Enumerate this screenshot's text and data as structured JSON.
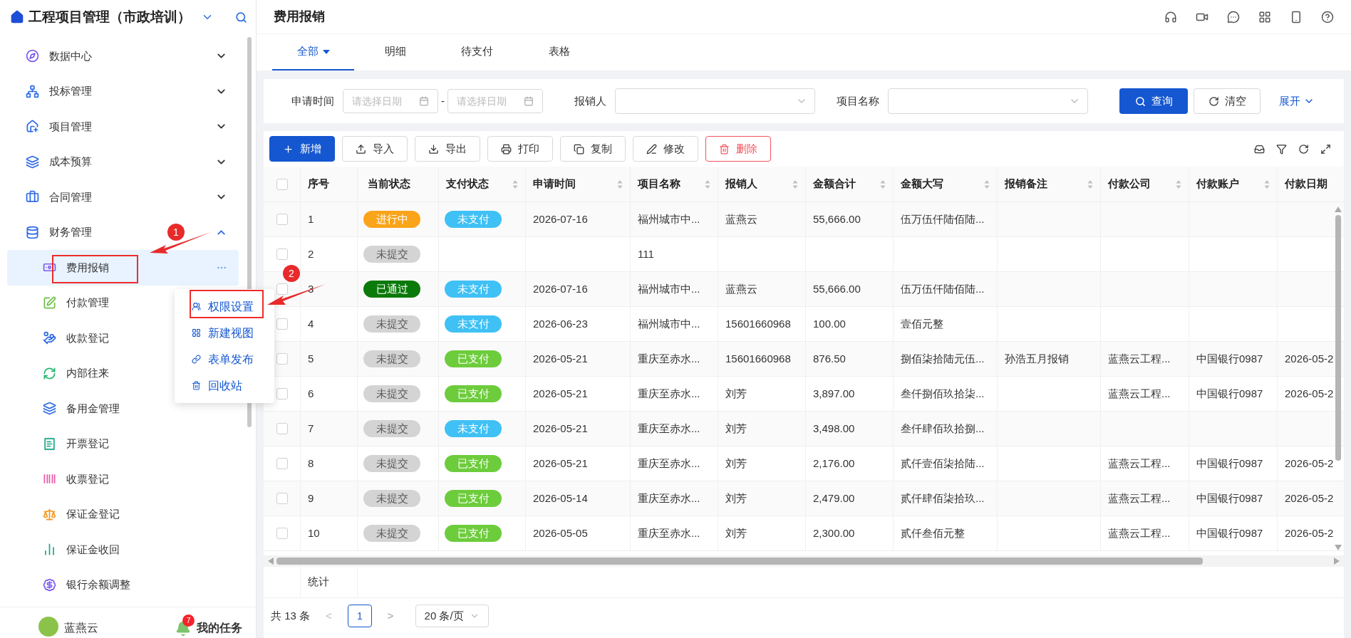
{
  "app": {
    "title": "工程项目管理（市政培训）"
  },
  "sidebar": {
    "items": [
      {
        "label": "数据中心",
        "expanded": false
      },
      {
        "label": "投标管理",
        "expanded": false
      },
      {
        "label": "项目管理",
        "expanded": false
      },
      {
        "label": "成本预算",
        "expanded": false
      },
      {
        "label": "合同管理",
        "expanded": false
      },
      {
        "label": "财务管理",
        "expanded": true,
        "children": [
          {
            "label": "费用报销",
            "selected": true
          },
          {
            "label": "付款管理",
            "selected": false
          },
          {
            "label": "收款登记",
            "selected": false
          },
          {
            "label": "内部往来",
            "selected": false
          },
          {
            "label": "备用金管理",
            "selected": false
          },
          {
            "label": "开票登记",
            "selected": false
          },
          {
            "label": "收票登记",
            "selected": false
          },
          {
            "label": "保证金登记",
            "selected": false
          },
          {
            "label": "保证金收回",
            "selected": false
          },
          {
            "label": "银行余额调整",
            "selected": false
          }
        ]
      }
    ],
    "user": {
      "name": "蓝燕云"
    },
    "tasks": {
      "label": "我的任务",
      "badge": "7"
    }
  },
  "context_menu": {
    "items": [
      "权限设置",
      "新建视图",
      "表单发布",
      "回收站"
    ]
  },
  "annotations": [
    {
      "number": "1"
    },
    {
      "number": "2"
    }
  ],
  "page": {
    "title": "费用报销"
  },
  "tabs": [
    {
      "label": "全部",
      "selected": true
    },
    {
      "label": "明细",
      "selected": false
    },
    {
      "label": "待支付",
      "selected": false
    },
    {
      "label": "表格",
      "selected": false
    }
  ],
  "filters": {
    "date_label": "申请时间",
    "date_start_placeholder": "请选择日期",
    "date_separator": "-",
    "date_end_placeholder": "请选择日期",
    "reporter_label": "报销人",
    "project_label": "项目名称",
    "query_button": "查询",
    "clear_button": "清空",
    "expand_link": "展开"
  },
  "toolbar": [
    {
      "label": "新增",
      "kind": "primary"
    },
    {
      "label": "导入",
      "kind": "default"
    },
    {
      "label": "导出",
      "kind": "default"
    },
    {
      "label": "打印",
      "kind": "default"
    },
    {
      "label": "复制",
      "kind": "default"
    },
    {
      "label": "修改",
      "kind": "default"
    },
    {
      "label": "删除",
      "kind": "danger"
    }
  ],
  "table": {
    "header_checked": false,
    "columns": [
      {
        "label": "序号",
        "sortable": false
      },
      {
        "label": "当前状态",
        "sortable": false
      },
      {
        "label": "支付状态",
        "sortable": true
      },
      {
        "label": "申请时间",
        "sortable": true
      },
      {
        "label": "项目名称",
        "sortable": true
      },
      {
        "label": "报销人",
        "sortable": true
      },
      {
        "label": "金额合计",
        "sortable": true
      },
      {
        "label": "金额大写",
        "sortable": true
      },
      {
        "label": "报销备注",
        "sortable": true
      },
      {
        "label": "付款公司",
        "sortable": true
      },
      {
        "label": "付款账户",
        "sortable": true
      },
      {
        "label": "付款日期",
        "sortable": false
      }
    ],
    "rows": [
      {
        "checked": false,
        "no": "1",
        "status": {
          "text": "进行中",
          "color": "#faa419"
        },
        "pay": {
          "text": "未支付",
          "color": "#3fc1f5"
        },
        "date": "2026-07-16",
        "project": "福州城市中...",
        "reporter": "蓝燕云",
        "amount": "55,666.00",
        "amount_words": "伍万伍仟陆佰陆...",
        "remark": "",
        "company": "",
        "account": "",
        "pay_date": ""
      },
      {
        "checked": false,
        "no": "2",
        "status": {
          "text": "未提交",
          "color": "#d4d4d4"
        },
        "date": "",
        "project": "111",
        "reporter": "",
        "amount": "",
        "amount_words": "",
        "remark": "",
        "company": "",
        "account": "",
        "pay_date": ""
      },
      {
        "checked": false,
        "no": "3",
        "status": {
          "text": "已通过",
          "color": "#0a7a0a"
        },
        "pay": {
          "text": "未支付",
          "color": "#3fc1f5"
        },
        "date": "2026-07-16",
        "project": "福州城市中...",
        "reporter": "蓝燕云",
        "amount": "55,666.00",
        "amount_words": "伍万伍仟陆佰陆...",
        "remark": "",
        "company": "",
        "account": "",
        "pay_date": ""
      },
      {
        "checked": false,
        "no": "4",
        "status": {
          "text": "未提交",
          "color": "#d4d4d4"
        },
        "pay": {
          "text": "未支付",
          "color": "#3fc1f5"
        },
        "date": "2026-06-23",
        "project": "福州城市中...",
        "reporter": "15601660968",
        "amount": "100.00",
        "amount_words": "壹佰元整",
        "remark": "",
        "company": "",
        "account": "",
        "pay_date": ""
      },
      {
        "checked": false,
        "no": "5",
        "status": {
          "text": "未提交",
          "color": "#d4d4d4"
        },
        "pay": {
          "text": "已支付",
          "color": "#6dcc3c"
        },
        "date": "2026-05-21",
        "project": "重庆至赤水...",
        "reporter": "15601660968",
        "amount": "876.50",
        "amount_words": "捌佰柒拾陆元伍...",
        "remark": "孙浩五月报销",
        "company": "蓝燕云工程...",
        "account": "中国银行0987",
        "pay_date": "2026-05-2"
      },
      {
        "checked": false,
        "no": "6",
        "status": {
          "text": "未提交",
          "color": "#d4d4d4"
        },
        "pay": {
          "text": "已支付",
          "color": "#6dcc3c"
        },
        "date": "2026-05-21",
        "project": "重庆至赤水...",
        "reporter": "刘芳",
        "amount": "3,897.00",
        "amount_words": "叁仟捌佰玖拾柒...",
        "remark": "",
        "company": "蓝燕云工程...",
        "account": "中国银行0987",
        "pay_date": "2026-05-2"
      },
      {
        "checked": false,
        "no": "7",
        "status": {
          "text": "未提交",
          "color": "#d4d4d4"
        },
        "pay": {
          "text": "未支付",
          "color": "#3fc1f5"
        },
        "date": "2026-05-21",
        "project": "重庆至赤水...",
        "reporter": "刘芳",
        "amount": "3,498.00",
        "amount_words": "叁仟肆佰玖拾捌...",
        "remark": "",
        "company": "",
        "account": "",
        "pay_date": ""
      },
      {
        "checked": false,
        "no": "8",
        "status": {
          "text": "未提交",
          "color": "#d4d4d4"
        },
        "pay": {
          "text": "已支付",
          "color": "#6dcc3c"
        },
        "date": "2026-05-21",
        "project": "重庆至赤水...",
        "reporter": "刘芳",
        "amount": "2,176.00",
        "amount_words": "贰仟壹佰柒拾陆...",
        "remark": "",
        "company": "蓝燕云工程...",
        "account": "中国银行0987",
        "pay_date": "2026-05-2"
      },
      {
        "checked": false,
        "no": "9",
        "status": {
          "text": "未提交",
          "color": "#d4d4d4"
        },
        "pay": {
          "text": "已支付",
          "color": "#6dcc3c"
        },
        "date": "2026-05-14",
        "project": "重庆至赤水...",
        "reporter": "刘芳",
        "amount": "2,479.00",
        "amount_words": "贰仟肆佰柒拾玖...",
        "remark": "",
        "company": "蓝燕云工程...",
        "account": "中国银行0987",
        "pay_date": "2026-05-2"
      },
      {
        "checked": false,
        "no": "10",
        "status": {
          "text": "未提交",
          "color": "#d4d4d4"
        },
        "pay": {
          "text": "已支付",
          "color": "#6dcc3c"
        },
        "date": "2026-05-05",
        "project": "重庆至赤水...",
        "reporter": "刘芳",
        "amount": "2,300.00",
        "amount_words": "贰仟叁佰元整",
        "remark": "",
        "company": "蓝燕云工程...",
        "account": "中国银行0987",
        "pay_date": "2026-05-2"
      }
    ],
    "summary_label": "统计"
  },
  "pagination": {
    "total": "共 13 条",
    "prev": "<",
    "pages": [
      {
        "label": "1",
        "selected": true
      }
    ],
    "next": ">",
    "page_size": "20 条/页"
  }
}
